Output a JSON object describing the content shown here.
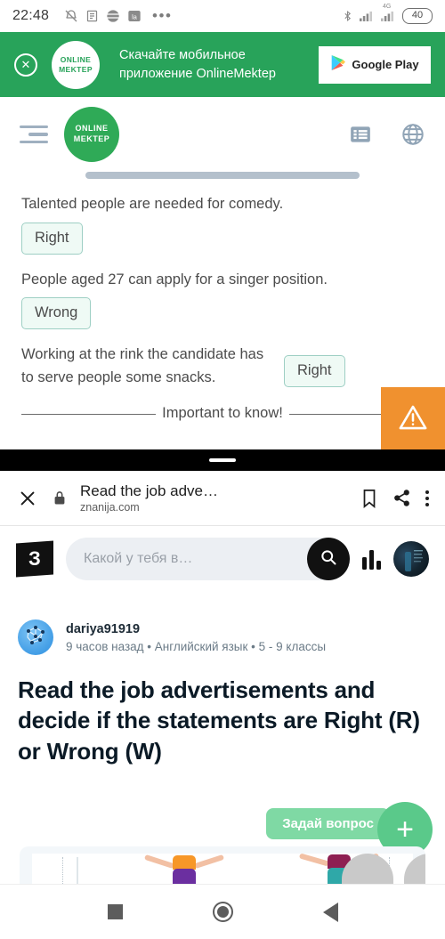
{
  "status_bar": {
    "time": "22:48",
    "battery": "40",
    "network": "4G",
    "icons": [
      "mute-icon",
      "document-icon",
      "globe-dark-icon",
      "app-badge-icon",
      "overflow-dots-icon",
      "bluetooth-icon",
      "signal-icon",
      "signal-4g-icon",
      "battery-icon"
    ]
  },
  "ad_banner": {
    "close_label": "✕",
    "logo_line1": "ONLINE",
    "logo_line2": "MEKTEP",
    "text_line1": "Скачайте мобильное",
    "text_line2": "приложение OnlineMektep",
    "store_button": "Google Play",
    "bg_color": "#28a35a"
  },
  "mektep_header": {
    "logo_line1": "ONLINE",
    "logo_line2": "MEKTEP",
    "menu_icon": "hamburger-indent-icon",
    "list_icon": "list-icon",
    "globe_icon": "globe-icon",
    "accent_color": "#2faa57"
  },
  "quiz": {
    "statements": [
      {
        "text": "Talented people are needed for comedy.",
        "answer": "Right",
        "inline": false
      },
      {
        "text": "People aged 27 can apply for a singer position.",
        "answer": "Wrong",
        "inline": false
      },
      {
        "text": "Working at the rink the candidate has to serve people some snacks.",
        "answer": "Right",
        "inline": true
      }
    ],
    "important_label": "Important to know!",
    "warning_icon": "warning-triangle-icon",
    "warning_color": "#f0912f",
    "answer_border_color": "#9ecfc4",
    "answer_bg_color": "#effaf5"
  },
  "browser_bar": {
    "close_icon": "close-icon",
    "lock_icon": "lock-icon",
    "title": "Read the job adve…",
    "url": "znanija.com",
    "bookmark_icon": "bookmark-icon",
    "share_icon": "share-icon",
    "menu_icon": "overflow-menu-icon"
  },
  "znanija_bar": {
    "logo": "З",
    "search_placeholder": "Какой у тебя в…",
    "search_value": "",
    "search_icon": "search-icon",
    "stats_icon": "bar-chart-icon",
    "avatar": "user-avatar"
  },
  "question": {
    "author": "dariya91919",
    "meta": "9 часов назад • Английский язык • 5 - 9 классы",
    "title": "Read the job advertisements and decide if the statements are Right (R) or Wrong (W)"
  },
  "ask_button": {
    "label": "Задай вопрос",
    "fab_label": "+",
    "color": "#5ac98a"
  },
  "nav_bar": {
    "recents": "recents-square-icon",
    "home": "home-circle-icon",
    "back": "back-triangle-icon"
  }
}
